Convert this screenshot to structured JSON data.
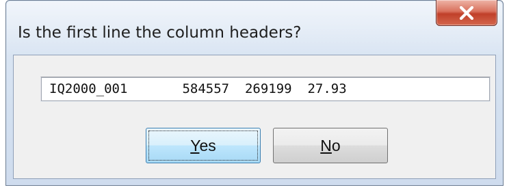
{
  "dialog": {
    "title": "Is the first line the column headers?",
    "close_label": "X",
    "first_line": "IQ2000_001       584557  269199  27.93",
    "buttons": {
      "yes": {
        "accesskey": "Y",
        "rest": "es"
      },
      "no": {
        "accesskey": "N",
        "rest": "o"
      }
    },
    "colors": {
      "close_button": "#c0402a",
      "default_button_border": "#3c7fb1",
      "client_bg": "#f0f0f0"
    }
  }
}
